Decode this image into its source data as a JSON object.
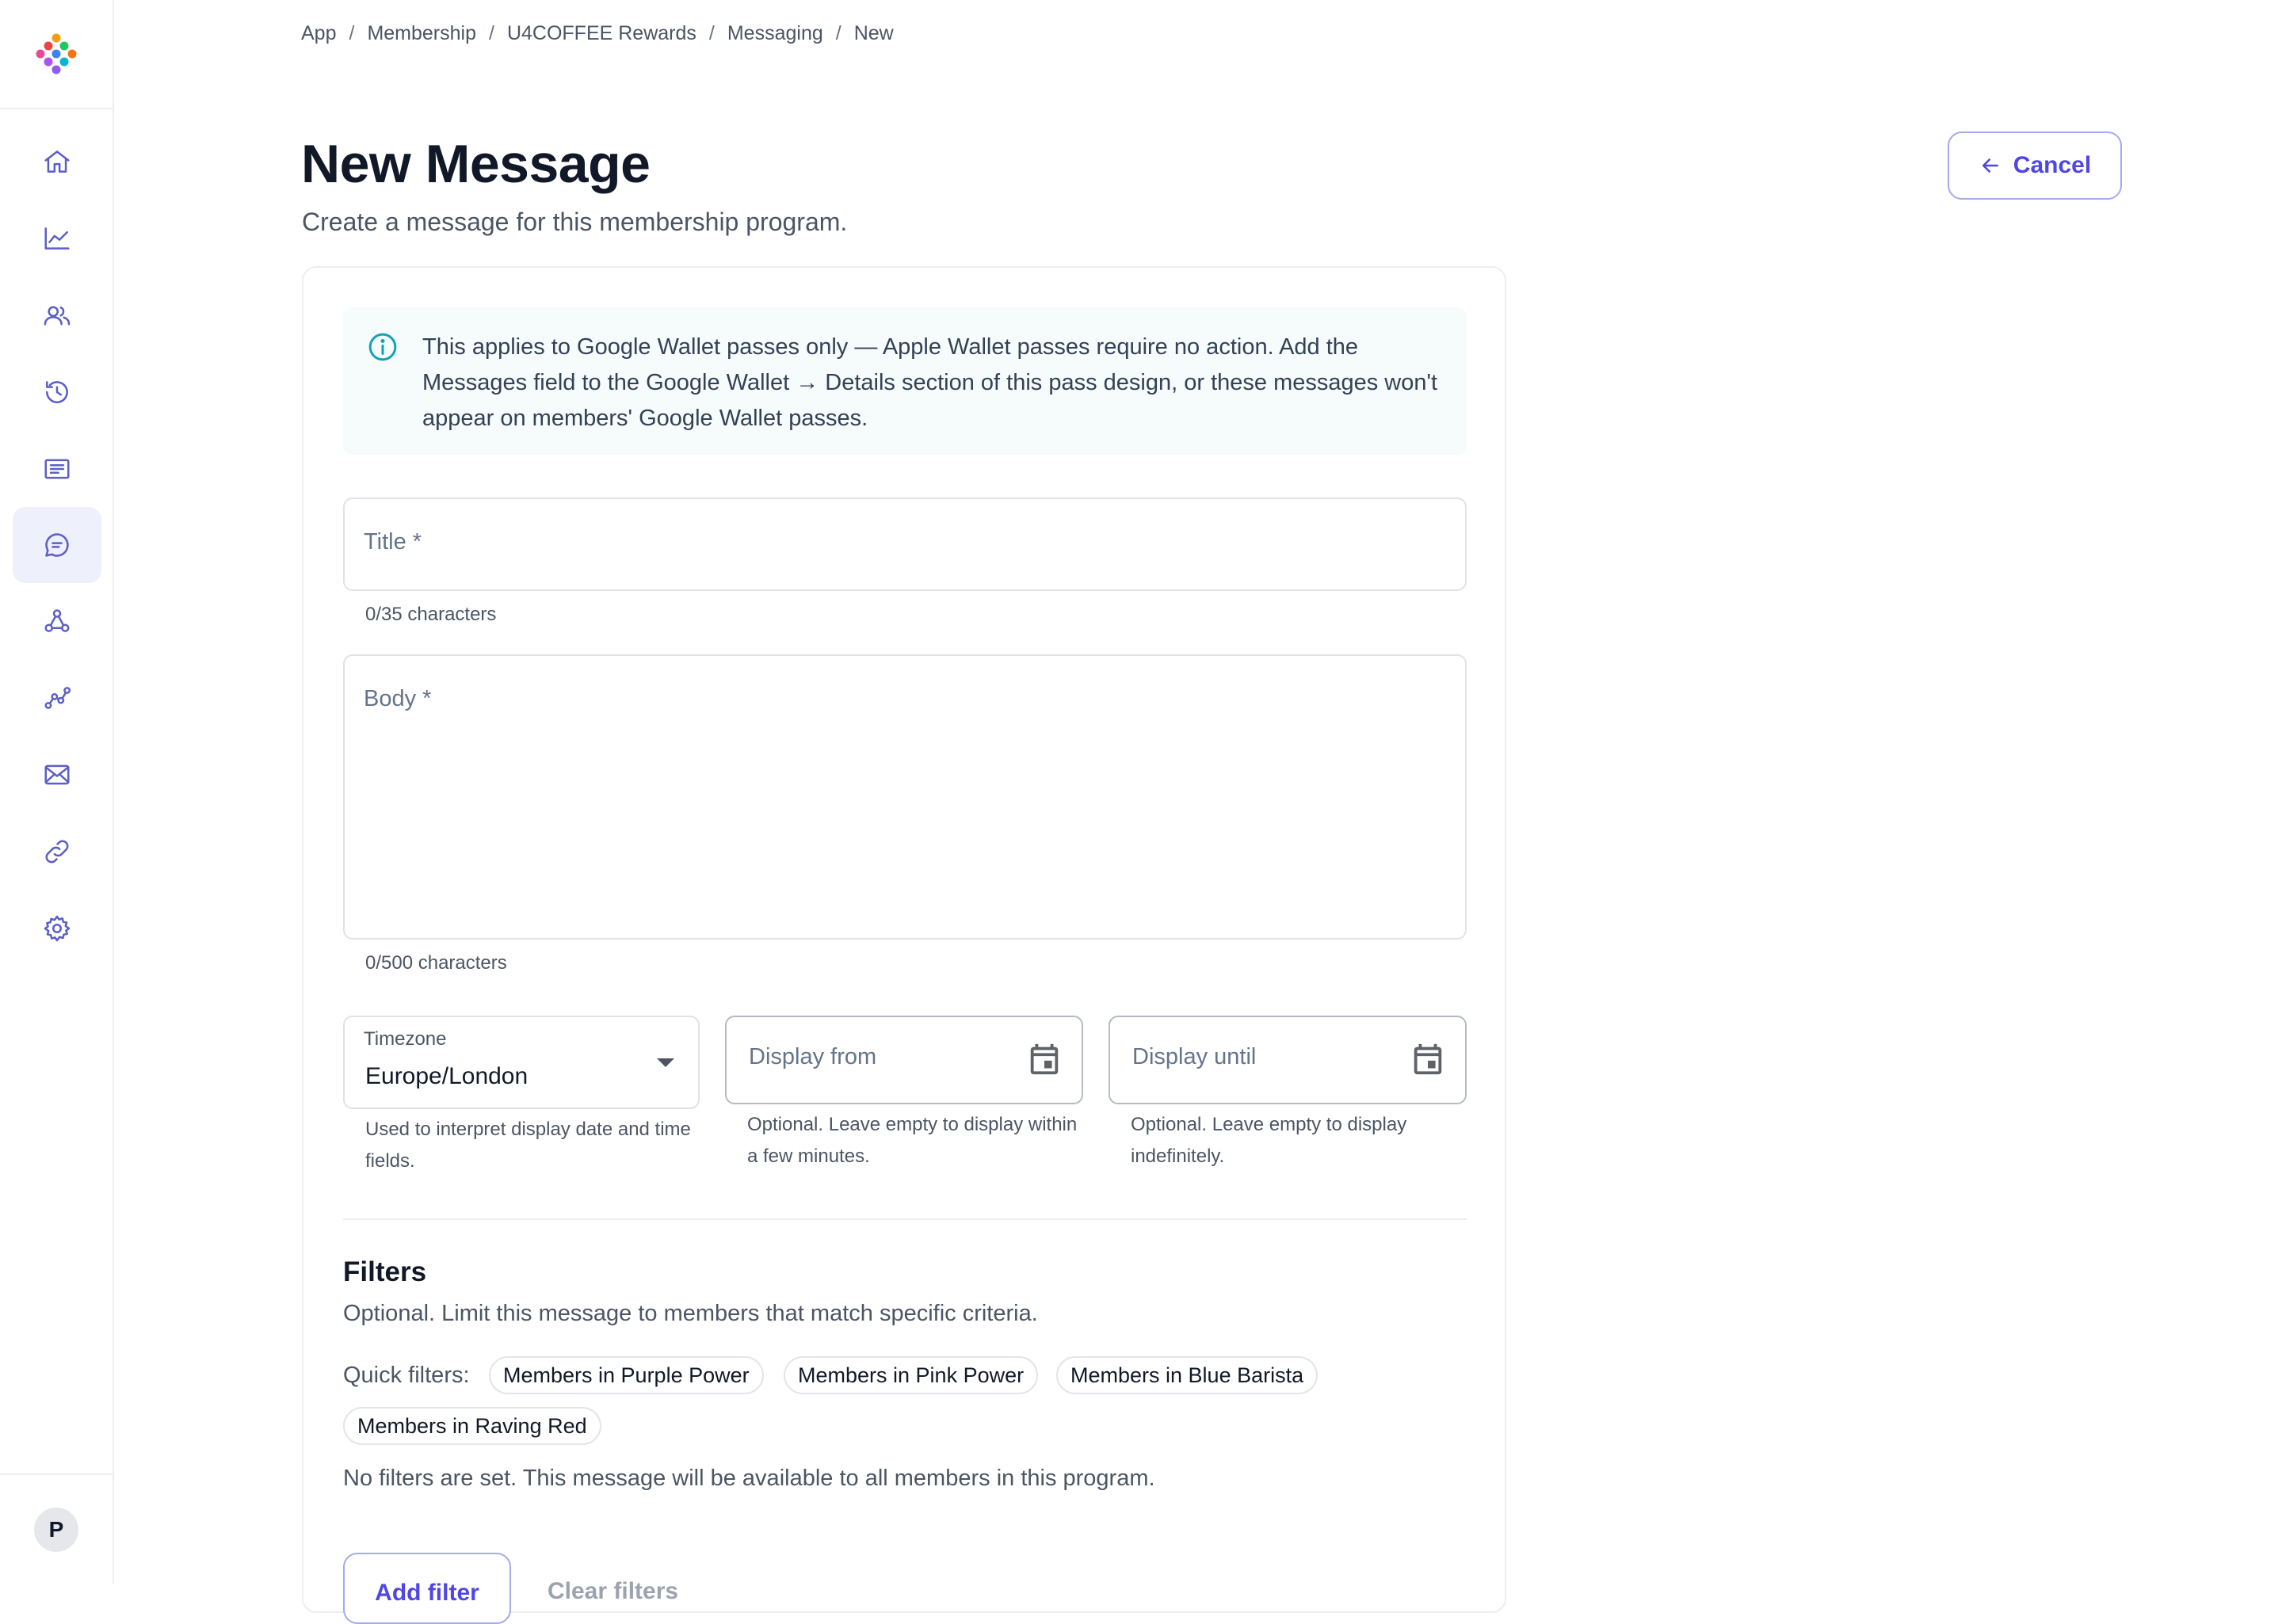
{
  "sidebar": {
    "logo": "multicolor-dots-logo",
    "items": [
      {
        "icon": "home-icon",
        "active": false
      },
      {
        "icon": "chart-icon",
        "active": false
      },
      {
        "icon": "users-icon",
        "active": false
      },
      {
        "icon": "history-icon",
        "active": false
      },
      {
        "icon": "receipt-icon",
        "active": false
      },
      {
        "icon": "message-icon",
        "active": true
      },
      {
        "icon": "webhook-icon",
        "active": false
      },
      {
        "icon": "analytics-icon",
        "active": false
      },
      {
        "icon": "mail-icon",
        "active": false
      },
      {
        "icon": "link-icon",
        "active": false
      },
      {
        "icon": "settings-icon",
        "active": false
      }
    ],
    "avatar_initial": "P"
  },
  "breadcrumb": {
    "items": [
      "App",
      "Membership",
      "U4COFFEE Rewards",
      "Messaging",
      "New"
    ],
    "separator": "/"
  },
  "header": {
    "title": "New Message",
    "subtitle": "Create a message for this membership program.",
    "cancel_label": "Cancel"
  },
  "info": {
    "text": "This applies to Google Wallet passes only — Apple Wallet passes require no action. Add the Messages field to the Google Wallet → Details section of this pass design, or these messages won't appear on members' Google Wallet passes."
  },
  "form": {
    "title_placeholder": "Title *",
    "title_counter": "0/35 characters",
    "body_placeholder": "Body *",
    "body_counter": "0/500 characters",
    "timezone_label": "Timezone",
    "timezone_value": "Europe/London",
    "timezone_help": "Used to interpret display date and time fields.",
    "display_from_placeholder": "Display from",
    "display_from_help": "Optional. Leave empty to display within a few minutes.",
    "display_until_placeholder": "Display until",
    "display_until_help": "Optional. Leave empty to display indefinitely."
  },
  "filters": {
    "title": "Filters",
    "subtitle": "Optional. Limit this message to members that match specific criteria.",
    "quick_label": "Quick filters:",
    "quick": [
      "Members in Purple Power",
      "Members in Pink Power",
      "Members in Blue Barista",
      "Members in Raving Red"
    ],
    "empty_text": "No filters are set. This message will be available to all members in this program.",
    "add_label": "Add filter",
    "clear_label": "Clear filters"
  },
  "colors": {
    "accent": "#4f46e5",
    "nav_icon": "#5b5fc7",
    "info_icon": "#0ea5b7",
    "active_bg": "#eef0fb"
  }
}
